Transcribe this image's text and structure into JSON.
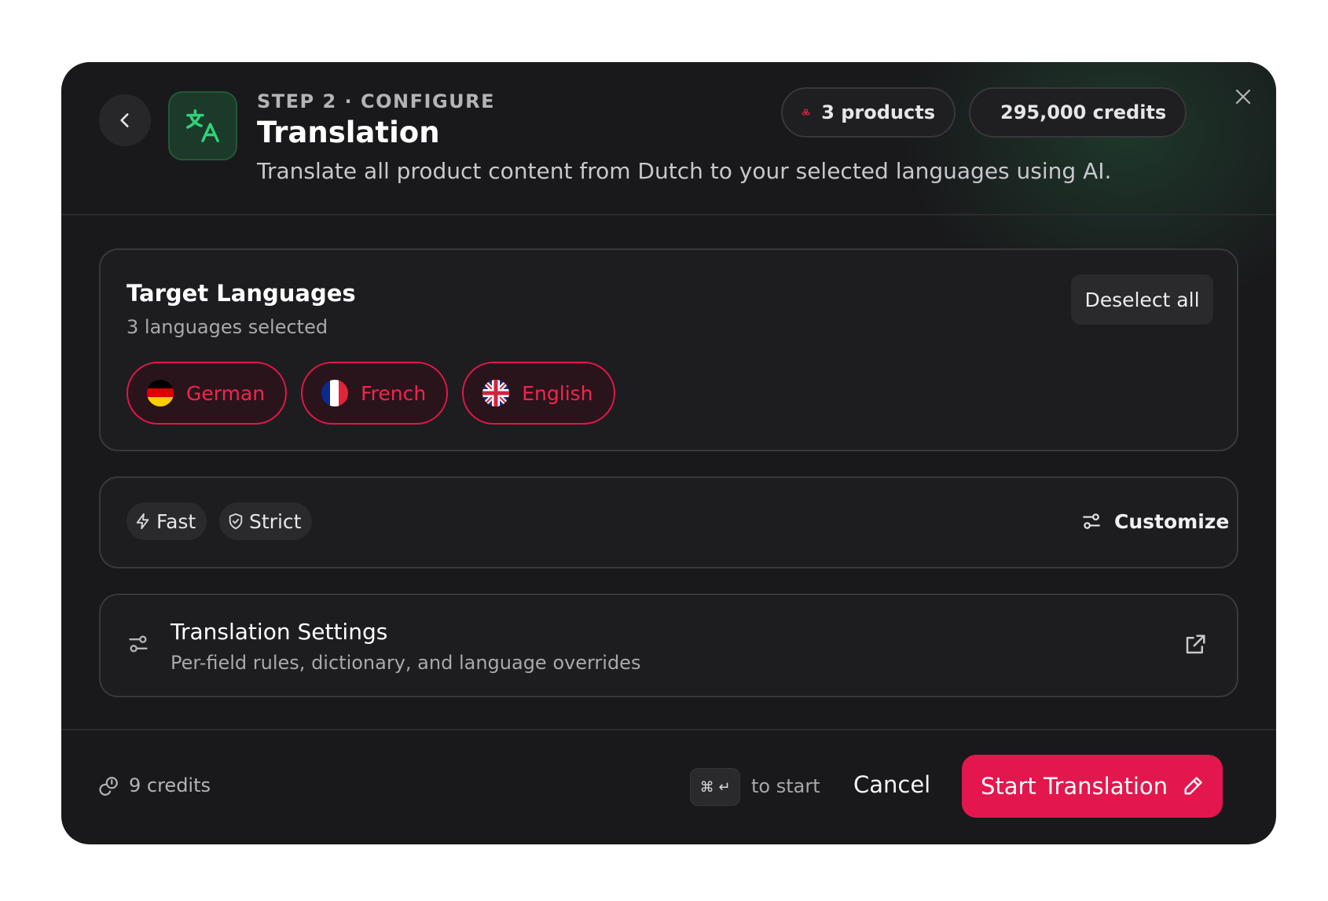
{
  "header": {
    "step_label": "STEP 2 · CONFIGURE",
    "title": "Translation",
    "subtitle": "Translate all product content from Dutch to your selected languages using AI.",
    "products_label": "3 products",
    "credits_label": "295,000 credits",
    "icons": {
      "back": "chevron-left-icon",
      "app": "translate-icon",
      "products": "boxes-icon",
      "credits": "coins-icon",
      "close": "close-icon"
    }
  },
  "languages": {
    "title": "Target Languages",
    "count_label": "3 languages selected",
    "deselect_label": "Deselect all",
    "items": [
      {
        "label": "German",
        "flag": "de-flag-icon"
      },
      {
        "label": "French",
        "flag": "fr-flag-icon"
      },
      {
        "label": "English",
        "flag": "gb-flag-icon"
      }
    ]
  },
  "modes": {
    "fast_label": "Fast",
    "strict_label": "Strict",
    "customize_label": "Customize",
    "icons": {
      "fast": "lightning-icon",
      "strict": "shield-check-icon",
      "customize": "sliders-icon"
    }
  },
  "settings": {
    "title": "Translation Settings",
    "subtitle": "Per-field rules, dictionary, and language overrides",
    "icons": {
      "settings": "sliders-icon",
      "open": "external-link-icon"
    }
  },
  "footer": {
    "cost_label": "9 credits",
    "shortcut": "⌘ ↵",
    "hint": "to start",
    "cancel_label": "Cancel",
    "start_label": "Start Translation"
  },
  "colors": {
    "accent": "#e3174d",
    "background": "#19191b",
    "app_icon": "#2fd37a",
    "credits_icon": "#f0a020"
  }
}
